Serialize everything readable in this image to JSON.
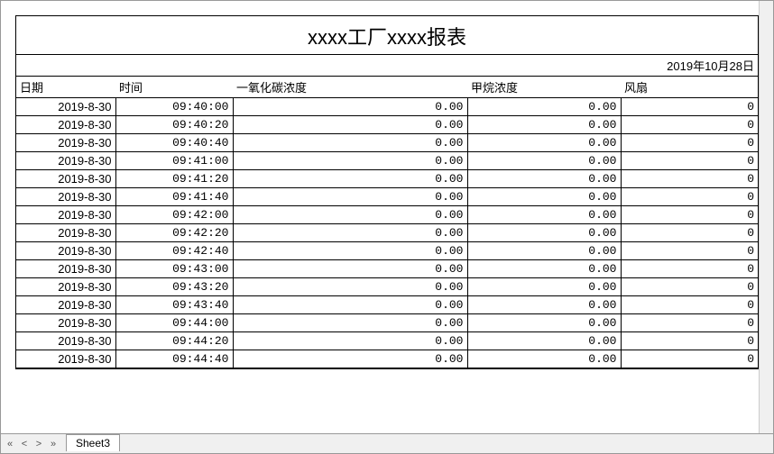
{
  "report": {
    "title": "xxxx工厂xxxx报表",
    "date": "2019年10月28日",
    "columns": {
      "date": "日期",
      "time": "时间",
      "co": "一氧化碳浓度",
      "ch4": "甲烷浓度",
      "fan": "风扇"
    },
    "rows": [
      {
        "date": "2019-8-30",
        "time": "09:40:00",
        "co": "0.00",
        "ch4": "0.00",
        "fan": "0"
      },
      {
        "date": "2019-8-30",
        "time": "09:40:20",
        "co": "0.00",
        "ch4": "0.00",
        "fan": "0"
      },
      {
        "date": "2019-8-30",
        "time": "09:40:40",
        "co": "0.00",
        "ch4": "0.00",
        "fan": "0"
      },
      {
        "date": "2019-8-30",
        "time": "09:41:00",
        "co": "0.00",
        "ch4": "0.00",
        "fan": "0"
      },
      {
        "date": "2019-8-30",
        "time": "09:41:20",
        "co": "0.00",
        "ch4": "0.00",
        "fan": "0"
      },
      {
        "date": "2019-8-30",
        "time": "09:41:40",
        "co": "0.00",
        "ch4": "0.00",
        "fan": "0"
      },
      {
        "date": "2019-8-30",
        "time": "09:42:00",
        "co": "0.00",
        "ch4": "0.00",
        "fan": "0"
      },
      {
        "date": "2019-8-30",
        "time": "09:42:20",
        "co": "0.00",
        "ch4": "0.00",
        "fan": "0"
      },
      {
        "date": "2019-8-30",
        "time": "09:42:40",
        "co": "0.00",
        "ch4": "0.00",
        "fan": "0"
      },
      {
        "date": "2019-8-30",
        "time": "09:43:00",
        "co": "0.00",
        "ch4": "0.00",
        "fan": "0"
      },
      {
        "date": "2019-8-30",
        "time": "09:43:20",
        "co": "0.00",
        "ch4": "0.00",
        "fan": "0"
      },
      {
        "date": "2019-8-30",
        "time": "09:43:40",
        "co": "0.00",
        "ch4": "0.00",
        "fan": "0"
      },
      {
        "date": "2019-8-30",
        "time": "09:44:00",
        "co": "0.00",
        "ch4": "0.00",
        "fan": "0"
      },
      {
        "date": "2019-8-30",
        "time": "09:44:20",
        "co": "0.00",
        "ch4": "0.00",
        "fan": "0"
      },
      {
        "date": "2019-8-30",
        "time": "09:44:40",
        "co": "0.00",
        "ch4": "0.00",
        "fan": "0"
      }
    ]
  },
  "sheetbar": {
    "nav": {
      "first": "«",
      "prev": "<",
      "next": ">",
      "last": "»"
    },
    "tab": "Sheet3"
  }
}
